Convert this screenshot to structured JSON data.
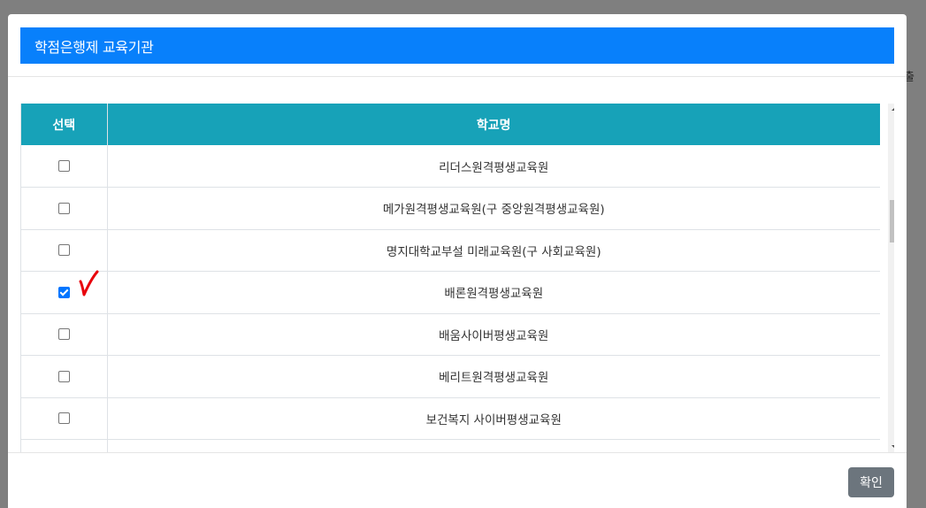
{
  "background_text": "출",
  "modal": {
    "title": "학점은행제 교육기관",
    "table": {
      "headers": {
        "select": "선택",
        "school": "학교명"
      },
      "rows": [
        {
          "school": "리더스원격평생교육원",
          "checked": false
        },
        {
          "school": "메가원격평생교육원(구 중앙원격평생교육원)",
          "checked": false
        },
        {
          "school": "명지대학교부설 미래교육원(구 사회교육원)",
          "checked": false
        },
        {
          "school": "배론원격평생교육원",
          "checked": true
        },
        {
          "school": "배움사이버평생교육원",
          "checked": false
        },
        {
          "school": "베리트원격평생교육원",
          "checked": false
        },
        {
          "school": "보건복지 사이버평생교육원",
          "checked": false
        },
        {
          "school": "",
          "checked": false
        }
      ]
    },
    "confirm_label": "확인"
  },
  "colors": {
    "title_bar": "#0880fb",
    "table_header": "#17a2b8",
    "confirm_button": "#6c757d",
    "annotation_mark": "#e8000b"
  }
}
